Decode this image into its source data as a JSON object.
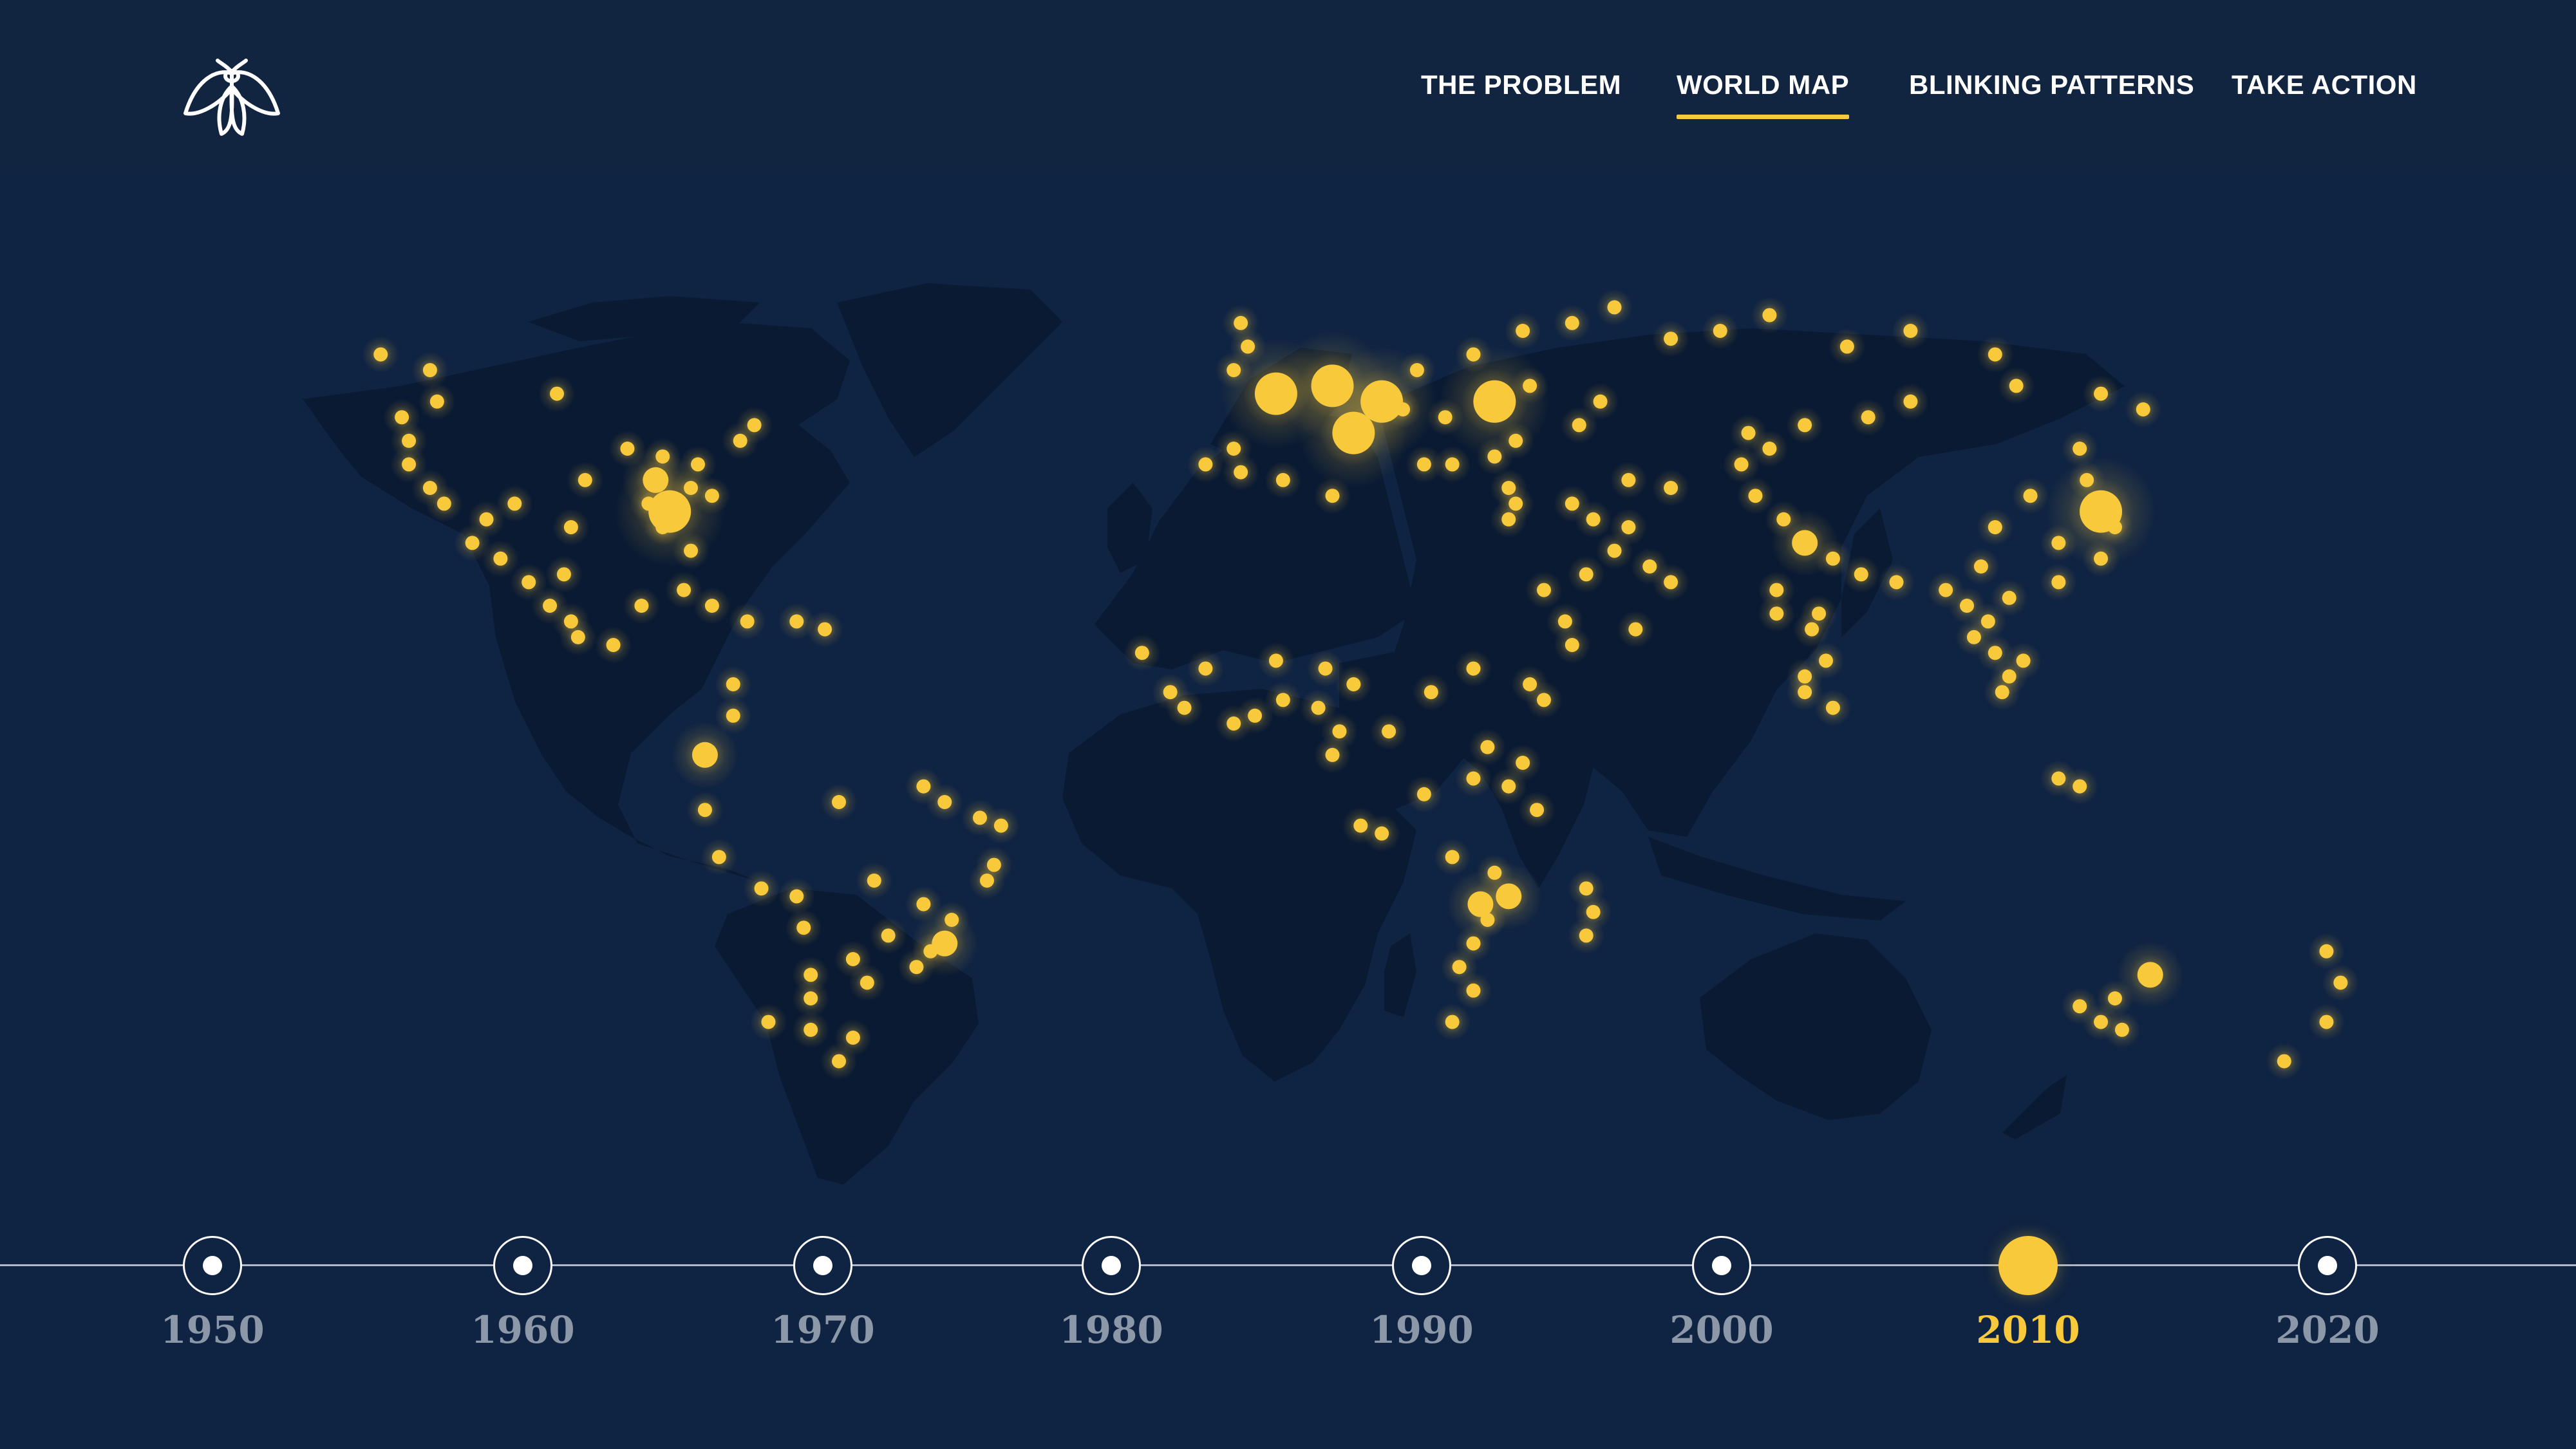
{
  "nav": {
    "items": [
      {
        "label": "THE PROBLEM",
        "active": false
      },
      {
        "label": "WORLD MAP",
        "active": true
      },
      {
        "label": "BLINKING PATTERNS",
        "active": false
      },
      {
        "label": "TAKE ACTION",
        "active": false
      }
    ]
  },
  "logo": {
    "icon": "firefly-icon"
  },
  "colors": {
    "background": "#0f2342",
    "header": "#112541",
    "land": "#0a1a33",
    "accent": "#f8c93a",
    "inactive_year": "#8c97a7"
  },
  "timeline": {
    "years": [
      "1950",
      "1960",
      "1970",
      "1980",
      "1990",
      "2000",
      "2010",
      "2020"
    ],
    "selected": "2010"
  },
  "map": {
    "marker_color": "#f8c93a",
    "marker_count_note": "",
    "points": [
      {
        "lat": 52,
        "lon": -125,
        "size": 1
      },
      {
        "lat": 50,
        "lon": -118,
        "size": 1
      },
      {
        "lat": 46,
        "lon": -117,
        "size": 1
      },
      {
        "lat": 44,
        "lon": -122,
        "size": 1
      },
      {
        "lat": 41,
        "lon": -121,
        "size": 1
      },
      {
        "lat": 38,
        "lon": -121,
        "size": 1
      },
      {
        "lat": 35,
        "lon": -118,
        "size": 1
      },
      {
        "lat": 33,
        "lon": -116,
        "size": 1
      },
      {
        "lat": 31,
        "lon": -110,
        "size": 1
      },
      {
        "lat": 33,
        "lon": -106,
        "size": 1
      },
      {
        "lat": 28,
        "lon": -112,
        "size": 1
      },
      {
        "lat": 26,
        "lon": -108,
        "size": 1
      },
      {
        "lat": 23,
        "lon": -104,
        "size": 1
      },
      {
        "lat": 20,
        "lon": -101,
        "size": 1
      },
      {
        "lat": 18,
        "lon": -98,
        "size": 1
      },
      {
        "lat": 16,
        "lon": -97,
        "size": 1
      },
      {
        "lat": 15,
        "lon": -92,
        "size": 1
      },
      {
        "lat": 24,
        "lon": -99,
        "size": 1
      },
      {
        "lat": 30,
        "lon": -98,
        "size": 1
      },
      {
        "lat": 36,
        "lon": -96,
        "size": 1
      },
      {
        "lat": 40,
        "lon": -90,
        "size": 1
      },
      {
        "lat": 39,
        "lon": -85,
        "size": 1
      },
      {
        "lat": 36,
        "lon": -86,
        "size": 2
      },
      {
        "lat": 33,
        "lon": -87,
        "size": 1
      },
      {
        "lat": 38,
        "lon": -80,
        "size": 1
      },
      {
        "lat": 35,
        "lon": -81,
        "size": 1
      },
      {
        "lat": 32,
        "lon": -84,
        "size": 3
      },
      {
        "lat": 30,
        "lon": -85,
        "size": 1
      },
      {
        "lat": 27,
        "lon": -81,
        "size": 1
      },
      {
        "lat": 34,
        "lon": -78,
        "size": 1
      },
      {
        "lat": 41,
        "lon": -74,
        "size": 1
      },
      {
        "lat": 43,
        "lon": -72,
        "size": 1
      },
      {
        "lat": 47,
        "lon": -100,
        "size": 1
      },
      {
        "lat": 22,
        "lon": -82,
        "size": 1
      },
      {
        "lat": 20,
        "lon": -78,
        "size": 1
      },
      {
        "lat": 18,
        "lon": -73,
        "size": 1
      },
      {
        "lat": 18,
        "lon": -66,
        "size": 1
      },
      {
        "lat": 17,
        "lon": -62,
        "size": 1
      },
      {
        "lat": 20,
        "lon": -88,
        "size": 1
      },
      {
        "lat": 10,
        "lon": -75,
        "size": 1
      },
      {
        "lat": 6,
        "lon": -75,
        "size": 1
      },
      {
        "lat": 1,
        "lon": -79,
        "size": 2
      },
      {
        "lat": -6,
        "lon": -79,
        "size": 1
      },
      {
        "lat": -12,
        "lon": -77,
        "size": 1
      },
      {
        "lat": -16,
        "lon": -71,
        "size": 1
      },
      {
        "lat": -17,
        "lon": -66,
        "size": 1
      },
      {
        "lat": -21,
        "lon": -65,
        "size": 1
      },
      {
        "lat": -5,
        "lon": -60,
        "size": 1
      },
      {
        "lat": -3,
        "lon": -48,
        "size": 1
      },
      {
        "lat": -5,
        "lon": -45,
        "size": 1
      },
      {
        "lat": -7,
        "lon": -40,
        "size": 1
      },
      {
        "lat": -8,
        "lon": -37,
        "size": 1
      },
      {
        "lat": -13,
        "lon": -38,
        "size": 1
      },
      {
        "lat": -15,
        "lon": -39,
        "size": 1
      },
      {
        "lat": -15,
        "lon": -55,
        "size": 1
      },
      {
        "lat": -18,
        "lon": -48,
        "size": 1
      },
      {
        "lat": -20,
        "lon": -44,
        "size": 1
      },
      {
        "lat": -23,
        "lon": -45,
        "size": 2
      },
      {
        "lat": -24,
        "lon": -47,
        "size": 1
      },
      {
        "lat": -26,
        "lon": -49,
        "size": 1
      },
      {
        "lat": -22,
        "lon": -53,
        "size": 1
      },
      {
        "lat": -25,
        "lon": -58,
        "size": 1
      },
      {
        "lat": -28,
        "lon": -56,
        "size": 1
      },
      {
        "lat": -27,
        "lon": -64,
        "size": 1
      },
      {
        "lat": -30,
        "lon": -64,
        "size": 1
      },
      {
        "lat": -33,
        "lon": -70,
        "size": 1
      },
      {
        "lat": -34,
        "lon": -64,
        "size": 1
      },
      {
        "lat": -35,
        "lon": -58,
        "size": 1
      },
      {
        "lat": -38,
        "lon": -60,
        "size": 1
      },
      {
        "lat": 50,
        "lon": -4,
        "size": 1
      },
      {
        "lat": 53,
        "lon": -2,
        "size": 1
      },
      {
        "lat": 56,
        "lon": -3,
        "size": 1
      },
      {
        "lat": 47,
        "lon": 2,
        "size": 3
      },
      {
        "lat": 48,
        "lon": 10,
        "size": 3
      },
      {
        "lat": 46,
        "lon": 17,
        "size": 3
      },
      {
        "lat": 42,
        "lon": 13,
        "size": 3
      },
      {
        "lat": 50,
        "lon": 22,
        "size": 1
      },
      {
        "lat": 52,
        "lon": 30,
        "size": 1
      },
      {
        "lat": 55,
        "lon": 37,
        "size": 1
      },
      {
        "lat": 56,
        "lon": 44,
        "size": 1
      },
      {
        "lat": 58,
        "lon": 50,
        "size": 1
      },
      {
        "lat": 54,
        "lon": 58,
        "size": 1
      },
      {
        "lat": 55,
        "lon": 65,
        "size": 1
      },
      {
        "lat": 57,
        "lon": 72,
        "size": 1
      },
      {
        "lat": 53,
        "lon": 83,
        "size": 1
      },
      {
        "lat": 55,
        "lon": 92,
        "size": 1
      },
      {
        "lat": 52,
        "lon": 104,
        "size": 1
      },
      {
        "lat": 46,
        "lon": 33,
        "size": 3
      },
      {
        "lat": 48,
        "lon": 38,
        "size": 1
      },
      {
        "lat": 46,
        "lon": 48,
        "size": 1
      },
      {
        "lat": 43,
        "lon": 45,
        "size": 1
      },
      {
        "lat": 41,
        "lon": 36,
        "size": 1
      },
      {
        "lat": 39,
        "lon": 33,
        "size": 1
      },
      {
        "lat": 38,
        "lon": 27,
        "size": 1
      },
      {
        "lat": 38,
        "lon": 23,
        "size": 1
      },
      {
        "lat": 44,
        "lon": 26,
        "size": 1
      },
      {
        "lat": 45,
        "lon": 20,
        "size": 1
      },
      {
        "lat": 40,
        "lon": -4,
        "size": 1
      },
      {
        "lat": 38,
        "lon": -8,
        "size": 1
      },
      {
        "lat": 37,
        "lon": -3,
        "size": 1
      },
      {
        "lat": 36,
        "lon": 3,
        "size": 1
      },
      {
        "lat": 34,
        "lon": 10,
        "size": 1
      },
      {
        "lat": 35,
        "lon": 35,
        "size": 1
      },
      {
        "lat": 33,
        "lon": 36,
        "size": 1
      },
      {
        "lat": 31,
        "lon": 35,
        "size": 1
      },
      {
        "lat": 33,
        "lon": 44,
        "size": 1
      },
      {
        "lat": 31,
        "lon": 47,
        "size": 1
      },
      {
        "lat": 36,
        "lon": 52,
        "size": 1
      },
      {
        "lat": 30,
        "lon": 52,
        "size": 1
      },
      {
        "lat": 35,
        "lon": 58,
        "size": 1
      },
      {
        "lat": 27,
        "lon": 50,
        "size": 1
      },
      {
        "lat": 24,
        "lon": 46,
        "size": 1
      },
      {
        "lat": 22,
        "lon": 40,
        "size": 1
      },
      {
        "lat": 18,
        "lon": 43,
        "size": 1
      },
      {
        "lat": 15,
        "lon": 44,
        "size": 1
      },
      {
        "lat": 17,
        "lon": 53,
        "size": 1
      },
      {
        "lat": 23,
        "lon": 58,
        "size": 1
      },
      {
        "lat": 25,
        "lon": 55,
        "size": 1
      },
      {
        "lat": 42,
        "lon": 69,
        "size": 1
      },
      {
        "lat": 40,
        "lon": 72,
        "size": 1
      },
      {
        "lat": 43,
        "lon": 77,
        "size": 1
      },
      {
        "lat": 38,
        "lon": 68,
        "size": 1
      },
      {
        "lat": 34,
        "lon": 70,
        "size": 1
      },
      {
        "lat": 31,
        "lon": 74,
        "size": 1
      },
      {
        "lat": 28,
        "lon": 77,
        "size": 2
      },
      {
        "lat": 26,
        "lon": 81,
        "size": 1
      },
      {
        "lat": 24,
        "lon": 85,
        "size": 1
      },
      {
        "lat": 23,
        "lon": 90,
        "size": 1
      },
      {
        "lat": 22,
        "lon": 73,
        "size": 1
      },
      {
        "lat": 19,
        "lon": 73,
        "size": 1
      },
      {
        "lat": 19,
        "lon": 79,
        "size": 1
      },
      {
        "lat": 17,
        "lon": 78,
        "size": 1
      },
      {
        "lat": 13,
        "lon": 80,
        "size": 1
      },
      {
        "lat": 11,
        "lon": 77,
        "size": 1
      },
      {
        "lat": 9,
        "lon": 77,
        "size": 1
      },
      {
        "lat": 7,
        "lon": 81,
        "size": 1
      },
      {
        "lat": 44,
        "lon": 86,
        "size": 1
      },
      {
        "lat": 46,
        "lon": 92,
        "size": 1
      },
      {
        "lat": 48,
        "lon": 107,
        "size": 1
      },
      {
        "lat": 47,
        "lon": 119,
        "size": 1
      },
      {
        "lat": 45,
        "lon": 125,
        "size": 1
      },
      {
        "lat": 40,
        "lon": 116,
        "size": 1
      },
      {
        "lat": 36,
        "lon": 117,
        "size": 1
      },
      {
        "lat": 32,
        "lon": 119,
        "size": 3
      },
      {
        "lat": 30,
        "lon": 121,
        "size": 1
      },
      {
        "lat": 28,
        "lon": 113,
        "size": 1
      },
      {
        "lat": 26,
        "lon": 119,
        "size": 1
      },
      {
        "lat": 23,
        "lon": 113,
        "size": 1
      },
      {
        "lat": 34,
        "lon": 109,
        "size": 1
      },
      {
        "lat": 30,
        "lon": 104,
        "size": 1
      },
      {
        "lat": 25,
        "lon": 102,
        "size": 1
      },
      {
        "lat": 22,
        "lon": 97,
        "size": 1
      },
      {
        "lat": 20,
        "lon": 100,
        "size": 1
      },
      {
        "lat": 18,
        "lon": 103,
        "size": 1
      },
      {
        "lat": 16,
        "lon": 101,
        "size": 1
      },
      {
        "lat": 14,
        "lon": 104,
        "size": 1
      },
      {
        "lat": 13,
        "lon": 108,
        "size": 1
      },
      {
        "lat": 11,
        "lon": 106,
        "size": 1
      },
      {
        "lat": 9,
        "lon": 105,
        "size": 1
      },
      {
        "lat": 21,
        "lon": 106,
        "size": 1
      },
      {
        "lat": -2,
        "lon": 113,
        "size": 1
      },
      {
        "lat": -3,
        "lon": 116,
        "size": 1
      },
      {
        "lat": 14,
        "lon": -17,
        "size": 1
      },
      {
        "lat": 12,
        "lon": -8,
        "size": 1
      },
      {
        "lat": 13,
        "lon": 2,
        "size": 1
      },
      {
        "lat": 12,
        "lon": 9,
        "size": 1
      },
      {
        "lat": 10,
        "lon": 13,
        "size": 1
      },
      {
        "lat": 8,
        "lon": 3,
        "size": 1
      },
      {
        "lat": 7,
        "lon": 8,
        "size": 1
      },
      {
        "lat": 6,
        "lon": -1,
        "size": 1
      },
      {
        "lat": 5,
        "lon": -4,
        "size": 1
      },
      {
        "lat": 7,
        "lon": -11,
        "size": 1
      },
      {
        "lat": 9,
        "lon": -13,
        "size": 1
      },
      {
        "lat": 4,
        "lon": 11,
        "size": 1
      },
      {
        "lat": 1,
        "lon": 10,
        "size": 1
      },
      {
        "lat": 4,
        "lon": 18,
        "size": 1
      },
      {
        "lat": 9,
        "lon": 24,
        "size": 1
      },
      {
        "lat": 12,
        "lon": 30,
        "size": 1
      },
      {
        "lat": 10,
        "lon": 38,
        "size": 1
      },
      {
        "lat": 8,
        "lon": 40,
        "size": 1
      },
      {
        "lat": 2,
        "lon": 32,
        "size": 1
      },
      {
        "lat": 0,
        "lon": 37,
        "size": 1
      },
      {
        "lat": -3,
        "lon": 35,
        "size": 1
      },
      {
        "lat": -6,
        "lon": 39,
        "size": 1
      },
      {
        "lat": -2,
        "lon": 30,
        "size": 1
      },
      {
        "lat": -4,
        "lon": 23,
        "size": 1
      },
      {
        "lat": -8,
        "lon": 14,
        "size": 1
      },
      {
        "lat": -9,
        "lon": 17,
        "size": 1
      },
      {
        "lat": -12,
        "lon": 27,
        "size": 1
      },
      {
        "lat": -14,
        "lon": 33,
        "size": 1
      },
      {
        "lat": -18,
        "lon": 31,
        "size": 2
      },
      {
        "lat": -17,
        "lon": 35,
        "size": 2
      },
      {
        "lat": -20,
        "lon": 32,
        "size": 1
      },
      {
        "lat": -23,
        "lon": 30,
        "size": 1
      },
      {
        "lat": -26,
        "lon": 28,
        "size": 1
      },
      {
        "lat": -29,
        "lon": 30,
        "size": 1
      },
      {
        "lat": -33,
        "lon": 27,
        "size": 1
      },
      {
        "lat": -19,
        "lon": 47,
        "size": 1
      },
      {
        "lat": -22,
        "lon": 46,
        "size": 1
      },
      {
        "lat": -16,
        "lon": 46,
        "size": 1
      },
      {
        "lat": -31,
        "lon": 116,
        "size": 1
      },
      {
        "lat": -33,
        "lon": 119,
        "size": 1
      },
      {
        "lat": -30,
        "lon": 121,
        "size": 1
      },
      {
        "lat": -27,
        "lon": 126,
        "size": 2
      },
      {
        "lat": -34,
        "lon": 122,
        "size": 1
      },
      {
        "lat": -28,
        "lon": 153,
        "size": 1
      },
      {
        "lat": -24,
        "lon": 151,
        "size": 1
      },
      {
        "lat": -33,
        "lon": 151,
        "size": 1
      },
      {
        "lat": -38,
        "lon": 145,
        "size": 1
      }
    ]
  }
}
